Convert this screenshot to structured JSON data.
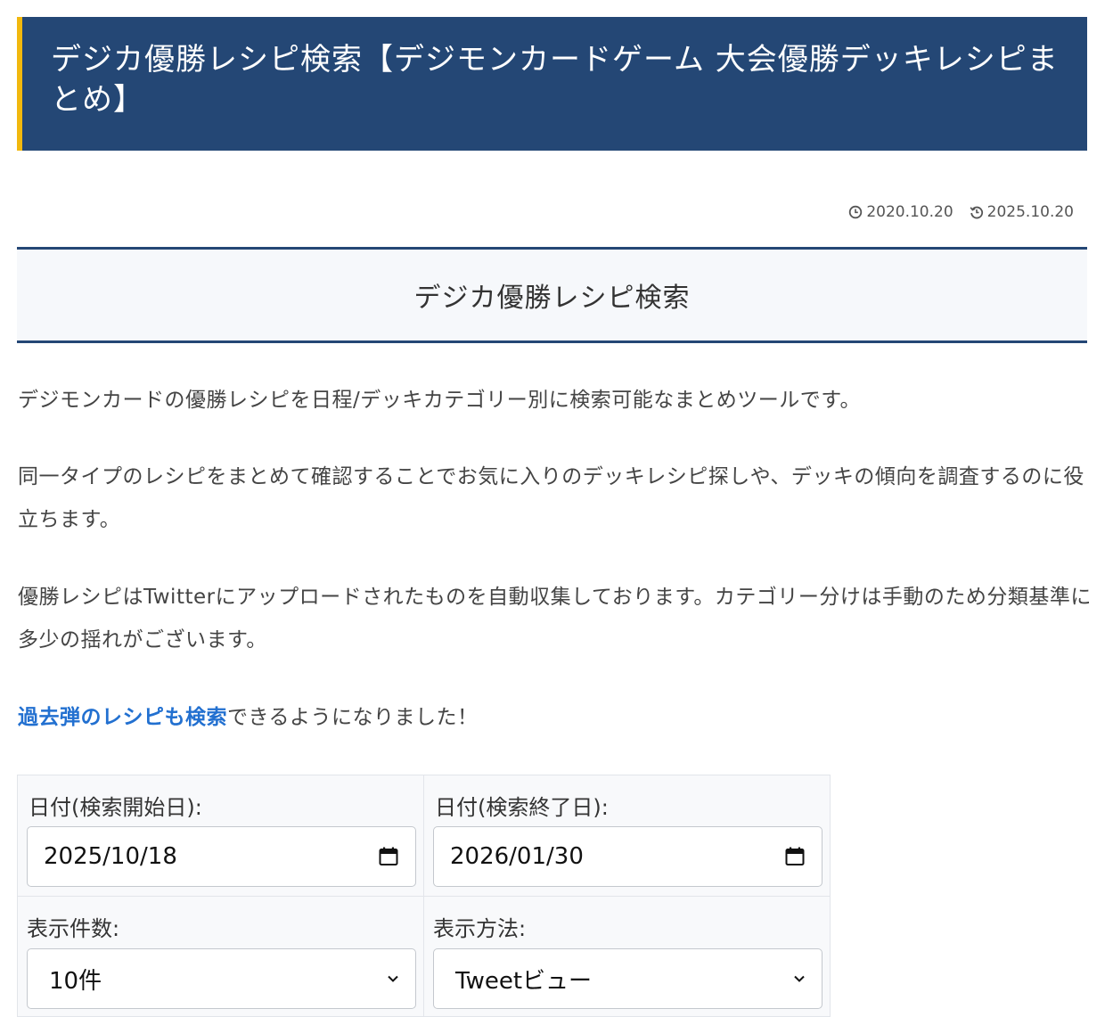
{
  "page": {
    "title": "デジカ優勝レシピ検索【デジモンカードゲーム 大会優勝デッキレシピまとめ】",
    "published_date": "2020.10.20",
    "updated_date": "2025.10.20",
    "section_heading": "デジカ優勝レシピ検索"
  },
  "content": {
    "p1": "デジモンカードの優勝レシピを日程/デッキカテゴリー別に検索可能なまとめツールです。",
    "p2": "同一タイプのレシピをまとめて確認することでお気に入りのデッキレシピ探しや、デッキの傾向を調査するのに役立ちます。",
    "p3": "優勝レシピはTwitterにアップロードされたものを自動収集しております。カテゴリー分けは手動のため分類基準に多少の揺れがございます。",
    "p4_link": "過去弾のレシピも検索",
    "p4_rest": "できるようになりました！"
  },
  "form": {
    "start_label": "日付(検索開始日):",
    "start_value": "2025/10/18",
    "end_label": "日付(検索終了日):",
    "end_value": "2026/01/30",
    "count_label": "表示件数:",
    "count_value": "10件",
    "mode_label": "表示方法:",
    "mode_value": "Tweetビュー"
  },
  "icons": {
    "published": "clock-icon",
    "updated": "history-icon",
    "calendar": "calendar-icon",
    "select": "chevron-down-icon"
  },
  "colors": {
    "title_bg": "#244775",
    "title_accent": "#f1b80e",
    "link": "#2270d0"
  }
}
